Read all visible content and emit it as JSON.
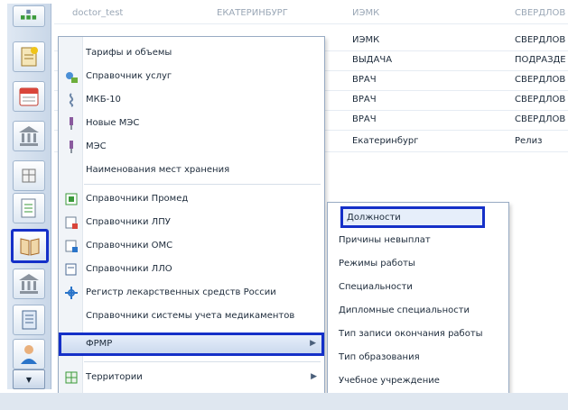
{
  "grid": {
    "rows": [
      {
        "c1": "doctor_test",
        "c2": "ЕКАТЕРИНБУРГ",
        "c3": "ИЭМК",
        "c4": "СВЕРДЛОВ",
        "head": true
      },
      {
        "c1": "",
        "c2": "",
        "c3": "ИЭМК",
        "c4": "СВЕРДЛОВ"
      },
      {
        "c1": "",
        "c2": "",
        "c3": "ВЫДАЧА",
        "c4": "ПОДРАЗДЕ"
      },
      {
        "c1": "",
        "c2": "",
        "c3": "ВРАЧ",
        "c4": "СВЕРДЛОВ"
      },
      {
        "c1": "",
        "c2": "",
        "c3": "ВРАЧ",
        "c4": "СВЕРДЛОВ"
      },
      {
        "c1": "",
        "c2": "",
        "c3": "ВРАЧ",
        "c4": "СВЕРДЛОВ"
      },
      {
        "c1": "",
        "c2": "",
        "c3": "Екатеринбург",
        "c4": "Релиз"
      }
    ]
  },
  "menu": {
    "items": [
      {
        "label": "Тарифы и объемы",
        "icon": "none"
      },
      {
        "label": "Справочник услуг",
        "icon": "services-icon"
      },
      {
        "label": "МКБ-10",
        "icon": "icd-icon"
      },
      {
        "label": "Новые МЭС",
        "icon": "mes-new-icon"
      },
      {
        "label": "МЭС",
        "icon": "mes-icon"
      },
      {
        "label": "Наименования мест хранения",
        "icon": "none"
      },
      {
        "label": "Справочники Промед",
        "icon": "book-icon"
      },
      {
        "label": "Справочники ЛПУ",
        "icon": "book-red-icon"
      },
      {
        "label": "Справочники ОМС",
        "icon": "book-blue-icon"
      },
      {
        "label": "Справочники ЛЛО",
        "icon": "book-icon"
      },
      {
        "label": "Регистр лекарственных средств России",
        "icon": "drug-register-icon"
      },
      {
        "label": "Справочники системы учета медикаментов",
        "icon": "none"
      },
      {
        "label": "ФРМР",
        "icon": "none"
      },
      {
        "label": "Территории",
        "icon": "territory-icon"
      }
    ]
  },
  "submenu": {
    "items": [
      "Должности",
      "Причины невыплат",
      "Режимы работы",
      "Специальности",
      "Дипломные специальности",
      "Тип записи окончания работы",
      "Тип образования",
      "Учебное учреждение"
    ]
  },
  "colors": {
    "highlight": "#1530c8",
    "menu_border": "#98abc3"
  }
}
